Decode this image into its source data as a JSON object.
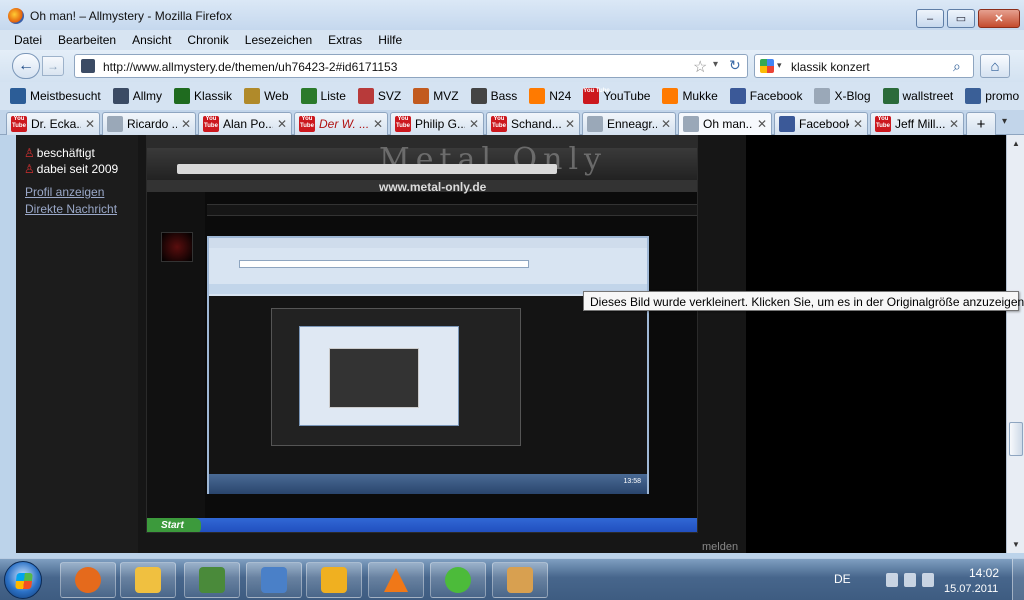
{
  "window": {
    "title": "Oh man! – Allmystery - Mozilla Firefox",
    "min": "–",
    "max": "▭",
    "close": "✕"
  },
  "menu": [
    "Datei",
    "Bearbeiten",
    "Ansicht",
    "Chronik",
    "Lesezeichen",
    "Extras",
    "Hilfe"
  ],
  "nav": {
    "back": "←",
    "forward": "→",
    "url": "http://www.allmystery.de/themen/uh76423-2#id6171153",
    "star": "☆",
    "dropdown": "▾",
    "reload": "↻",
    "search_query": "klassik konzert",
    "search_drop": "▾",
    "search_icon": "⌕",
    "home": "⌂"
  },
  "bookmarks": [
    {
      "label": "Meistbesucht",
      "icon": "bookmark-icon",
      "color": "#2c5d97"
    },
    {
      "label": "Allmy",
      "icon": "allmy-icon",
      "color": "#3b4b64"
    },
    {
      "label": "Klassik",
      "icon": "klassik-icon",
      "color": "#1f6b1f"
    },
    {
      "label": "Web",
      "icon": "web-icon",
      "color": "#b08a2a"
    },
    {
      "label": "Liste",
      "icon": "liste-icon",
      "color": "#2b7a2b"
    },
    {
      "label": "SVZ",
      "icon": "svz-icon",
      "color": "#b83a3a"
    },
    {
      "label": "MVZ",
      "icon": "mvz-icon",
      "color": "#c25b1f"
    },
    {
      "label": "Bass",
      "icon": "bass-icon",
      "color": "#444444"
    },
    {
      "label": "N24",
      "icon": "n24-icon",
      "color": "#ff7a00"
    },
    {
      "label": "YouTube",
      "icon": "youtube-icon",
      "color": "#cc181e"
    },
    {
      "label": "Mukke",
      "icon": "mukke-icon",
      "color": "#ff7a00"
    },
    {
      "label": "Facebook",
      "icon": "facebook-icon",
      "color": "#3b5998"
    },
    {
      "label": "X-Blog",
      "icon": "page-icon",
      "color": "#9aa8b8"
    },
    {
      "label": "wallstreet",
      "icon": "wallstreet-icon",
      "color": "#2b6b3a"
    },
    {
      "label": "promo",
      "icon": "promo-icon",
      "color": "#3a5f97"
    }
  ],
  "tabs": [
    {
      "label": "Dr. Ecka...",
      "icon": "youtube-icon",
      "active": false
    },
    {
      "label": "Ricardo ...",
      "icon": "page-icon",
      "active": false
    },
    {
      "label": "Alan Po...",
      "icon": "youtube-icon",
      "active": false
    },
    {
      "label": "Der W. ...",
      "icon": "youtube-icon",
      "active": false
    },
    {
      "label": "Philip G...",
      "icon": "youtube-icon",
      "active": false
    },
    {
      "label": "Schand...",
      "icon": "youtube-icon",
      "active": false
    },
    {
      "label": "Enneagr...",
      "icon": "page-icon",
      "active": false
    },
    {
      "label": "Oh man...",
      "icon": "allmy-icon",
      "active": true
    },
    {
      "label": "Facebook",
      "icon": "facebook-icon",
      "active": false
    },
    {
      "label": "Jeff Mill...",
      "icon": "youtube-icon",
      "active": false
    }
  ],
  "tab_close": "✕",
  "tab_new": "+",
  "tab_list": "▾",
  "youtube_badge": "You Tube",
  "content": {
    "status": "beschäftigt",
    "member_since": "dabei seit 2009",
    "profile_link": "Profil anzeigen",
    "message_link": "Direkte Nachricht",
    "report": "melden",
    "nested_logo": "Metal Only",
    "nested_site": "www.metal-only.de",
    "nested_start": "Start",
    "deep_clock": "13:58"
  },
  "scrollbar": {
    "up": "▲",
    "down": "▼"
  },
  "tooltip": "Dieses Bild wurde verkleinert. Klicken Sie, um es in der Originalgröße anzuzeigen.",
  "taskbar": {
    "apps": [
      {
        "name": "firefox",
        "color": "#e56a1c"
      },
      {
        "name": "explorer",
        "color": "#f0c040"
      },
      {
        "name": "system",
        "color": "#4a8a3a"
      },
      {
        "name": "thunderbird",
        "color": "#4a80c8"
      },
      {
        "name": "winamp",
        "color": "#f0b020"
      },
      {
        "name": "vlc",
        "color": "#f07818"
      },
      {
        "name": "icq",
        "color": "#4cbb3a"
      },
      {
        "name": "paint",
        "color": "#d8a050"
      }
    ],
    "lang": "DE",
    "time": "14:02",
    "date": "15.07.2011"
  }
}
